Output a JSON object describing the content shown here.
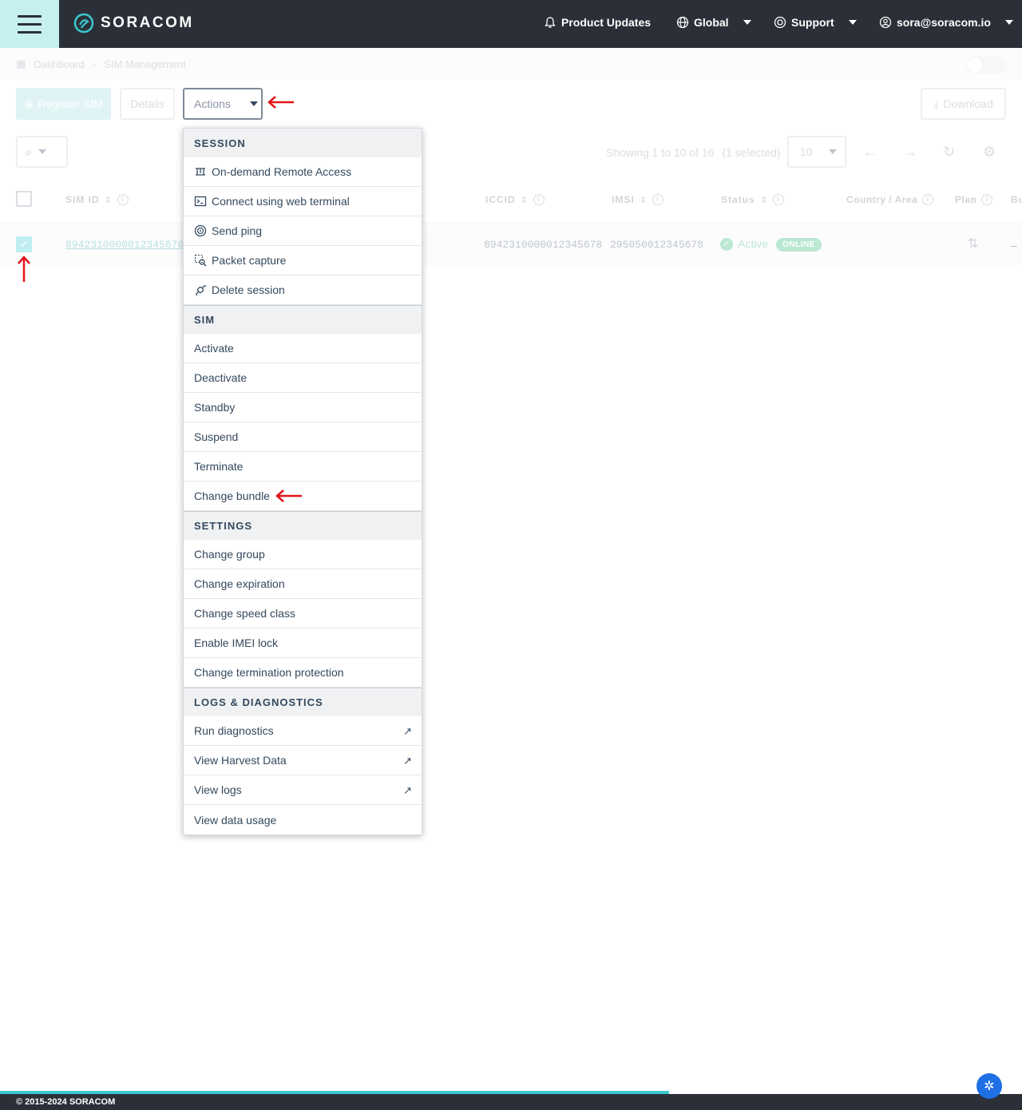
{
  "header": {
    "brand": "SORACOM",
    "product_updates": "Product Updates",
    "region": "Global",
    "support": "Support",
    "account": "sora@soracom.io"
  },
  "breadcrumb": {
    "dashboard": "Dashboard",
    "current": "SIM Management"
  },
  "toolbar": {
    "register_sim": "Register SIM",
    "details": "Details",
    "actions": "Actions",
    "download": "Download"
  },
  "pagination": {
    "showing": "Showing 1 to 10 of 16",
    "selected": "(1 selected)",
    "per_page": "10"
  },
  "table": {
    "columns": {
      "sim_id": "SIM ID",
      "iccid": "ICCID",
      "imsi": "IMSI",
      "status": "Status",
      "country": "Country / Area",
      "plan": "Plan",
      "bundle": "Bu"
    },
    "rows": [
      {
        "sim_id": "8942310000012345678",
        "iccid": "8942310000012345678",
        "imsi": "295050012345678",
        "status": "Active",
        "online": "ONLINE",
        "dash": "–"
      }
    ]
  },
  "menu": {
    "session": {
      "label": "SESSION",
      "items": [
        "On-demand Remote Access",
        "Connect using web terminal",
        "Send ping",
        "Packet capture",
        "Delete session"
      ]
    },
    "sim": {
      "label": "SIM",
      "items": [
        "Activate",
        "Deactivate",
        "Standby",
        "Suspend",
        "Terminate",
        "Change bundle"
      ]
    },
    "settings": {
      "label": "SETTINGS",
      "items": [
        "Change group",
        "Change expiration",
        "Change speed class",
        "Enable IMEI lock",
        "Change termination protection"
      ]
    },
    "logs": {
      "label": "LOGS & DIAGNOSTICS",
      "items": [
        "Run diagnostics",
        "View Harvest Data",
        "View logs",
        "View data usage"
      ]
    }
  },
  "footer": {
    "copyright": "© 2015-2024 SORACOM"
  },
  "colors": {
    "topbar": "#2b3038",
    "accent": "#3bc8d0",
    "annotation": "#e3141a"
  }
}
